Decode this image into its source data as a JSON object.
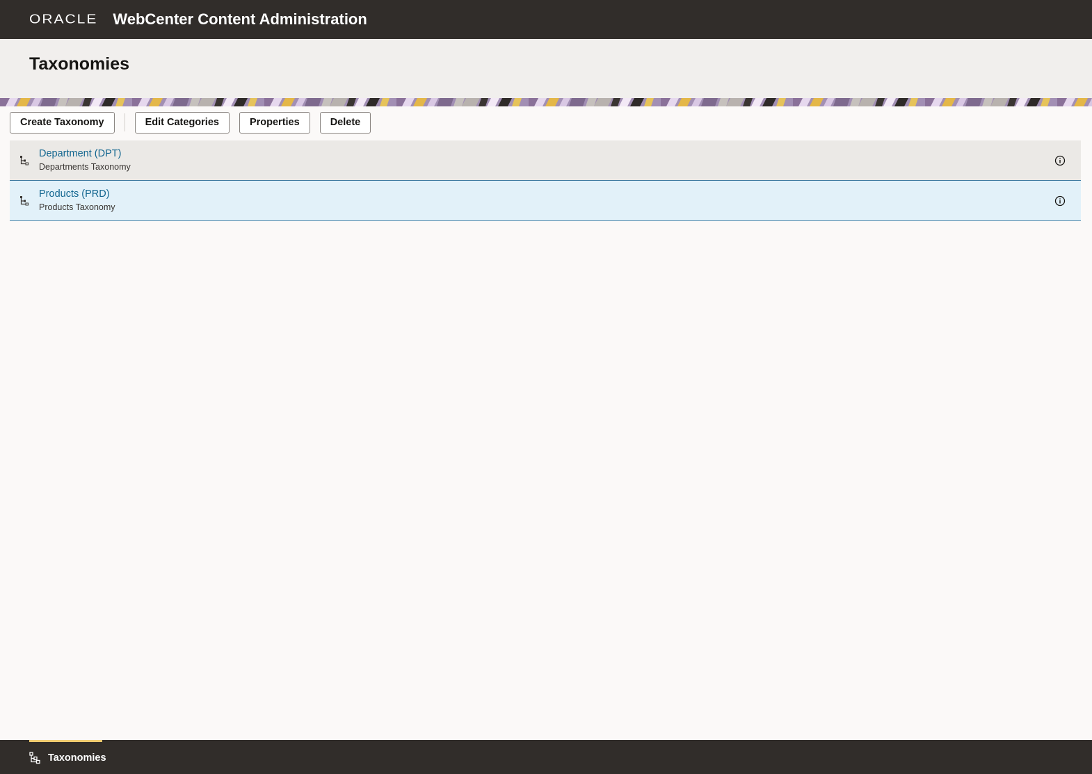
{
  "header": {
    "logo_text": "ORACLE",
    "app_title": "WebCenter Content Administration"
  },
  "page": {
    "title": "Taxonomies"
  },
  "toolbar": {
    "create_label": "Create Taxonomy",
    "edit_label": "Edit Categories",
    "properties_label": "Properties",
    "delete_label": "Delete"
  },
  "taxonomies": [
    {
      "name": "Department (DPT)",
      "description": "Departments Taxonomy",
      "icon": "taxonomy-tree-icon"
    },
    {
      "name": "Products (PRD)",
      "description": "Products Taxonomy",
      "icon": "taxonomy-tree-icon"
    }
  ],
  "footer": {
    "tab_label": "Taxonomies",
    "tab_icon": "taxonomy-tree-icon"
  },
  "colors": {
    "header_bg": "#312d2a",
    "link": "#11658f",
    "selected_row_bg": "#e2f1f9",
    "active_tab_indicator": "#f0cc71"
  }
}
